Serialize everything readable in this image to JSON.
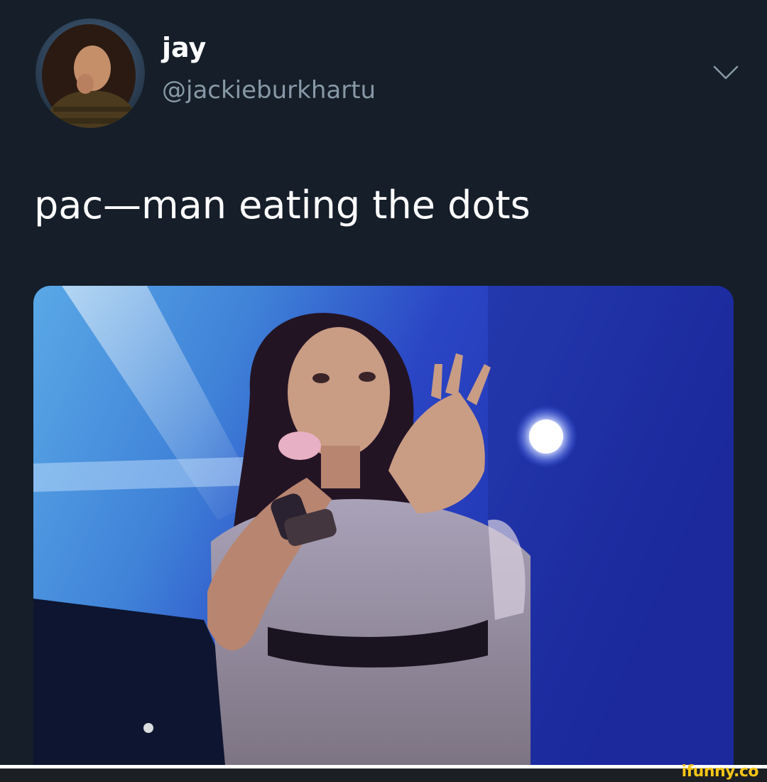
{
  "tweet": {
    "author": {
      "display_name": "jay",
      "handle": "@jackieburkhartu",
      "avatar_icon": "profile-photo"
    },
    "text": "pac—man eating the dots",
    "menu_icon": "chevron-down-icon",
    "media": {
      "kind": "video-still",
      "description_icon": "concert-performer-photo"
    }
  },
  "watermark": "ifunny.co",
  "colors": {
    "background": "#151e29",
    "primary_text": "#ffffff",
    "secondary_text": "#8899a6",
    "watermark": "#f5c518"
  }
}
